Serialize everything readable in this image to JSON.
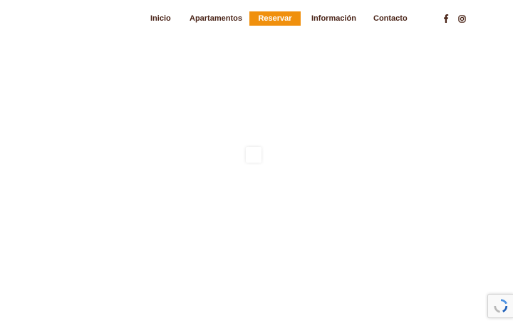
{
  "nav": {
    "items": [
      {
        "label": "Inicio"
      },
      {
        "label": "Apartamentos"
      },
      {
        "label": "Reservar",
        "active": true
      },
      {
        "label": "Información"
      },
      {
        "label": "Contacto"
      }
    ]
  },
  "social": {
    "icons": [
      "facebook-icon",
      "instagram-icon"
    ]
  },
  "colors": {
    "accent": "#f0900d",
    "nav_text": "#4a2418",
    "background": "#ffffff"
  },
  "widgets": {
    "loader": "loading-spinner",
    "recaptcha": "recaptcha-badge"
  }
}
